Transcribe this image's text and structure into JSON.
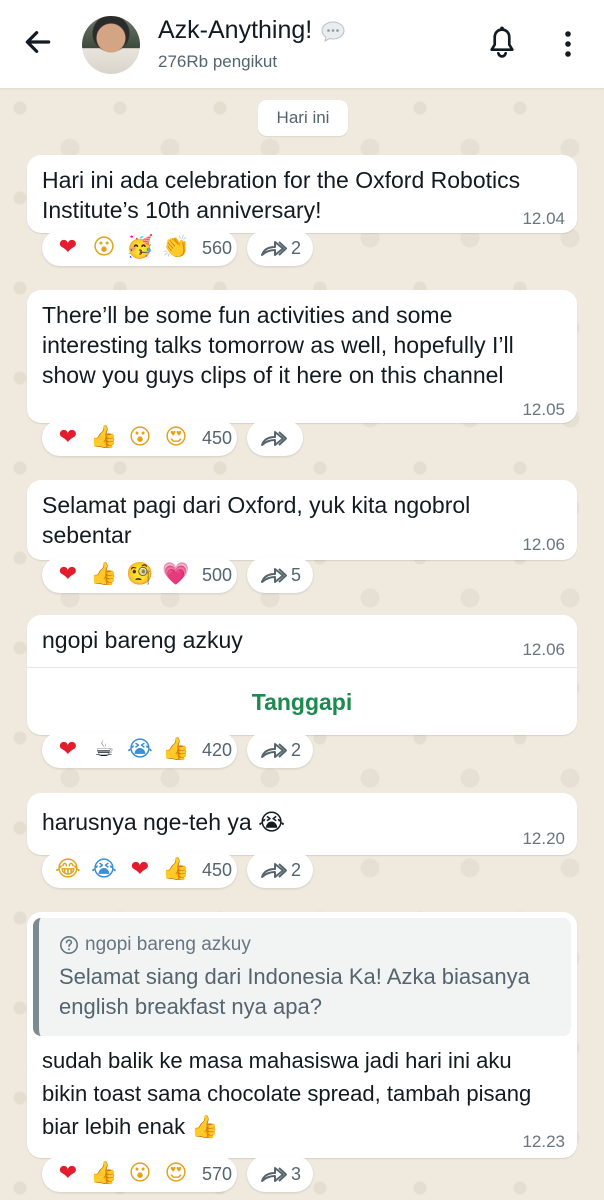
{
  "header": {
    "title": "Azk-Anything!",
    "followers": "276Rb pengikut"
  },
  "date_label": "Hari ini",
  "messages": [
    {
      "text": "Hari ini ada celebration for the Oxford Robotics Institute’s 10th anniversary!",
      "time": "12.04",
      "reactions": [
        "❤",
        "😮",
        "🥳",
        "👏"
      ],
      "reaction_count": "560",
      "forwards": "2"
    },
    {
      "text": "There’ll be some fun activities and some interesting talks tomorrow as well, hopefully I’ll show you guys clips of it here on this channel",
      "time": "12.05",
      "reactions": [
        "❤",
        "👍",
        "😮",
        "😍"
      ],
      "reaction_count": "450",
      "forwards": ""
    },
    {
      "text": "Selamat pagi dari Oxford, yuk kita ngobrol sebentar",
      "time": "12.06",
      "reactions": [
        "❤",
        "👍",
        "🧐",
        "💗"
      ],
      "reaction_count": "500",
      "forwards": "5"
    },
    {
      "text": "ngopi bareng azkuy",
      "time": "12.06",
      "reply_label": "Tanggapi",
      "reactions": [
        "❤",
        "☕",
        "😭",
        "👍"
      ],
      "reaction_count": "420",
      "forwards": "2"
    },
    {
      "text": "harusnya nge-teh ya 😭",
      "time": "12.20",
      "reactions": [
        "😂",
        "😭",
        "❤",
        "👍"
      ],
      "reaction_count": "450",
      "forwards": "2"
    },
    {
      "quote_author": "ngopi bareng azkuy",
      "quote_text": "Selamat siang dari Indonesia Ka! Azka biasanya english breakfast nya apa?",
      "text": "sudah balik ke masa mahasiswa jadi hari ini aku bikin toast sama chocolate spread, tambah pisang biar lebih enak 👍",
      "time": "12.23",
      "reactions": [
        "❤",
        "👍",
        "😮",
        "😍"
      ],
      "reaction_count": "570",
      "forwards": "3"
    }
  ],
  "colors": {
    "accent_green": "#1d8a4f",
    "background": "#efe9de",
    "bubble": "#ffffff"
  },
  "icons": [
    "back-arrow-icon",
    "chat-bubble-icon",
    "bell-icon",
    "more-vertical-icon",
    "forward-icon",
    "question-icon"
  ]
}
